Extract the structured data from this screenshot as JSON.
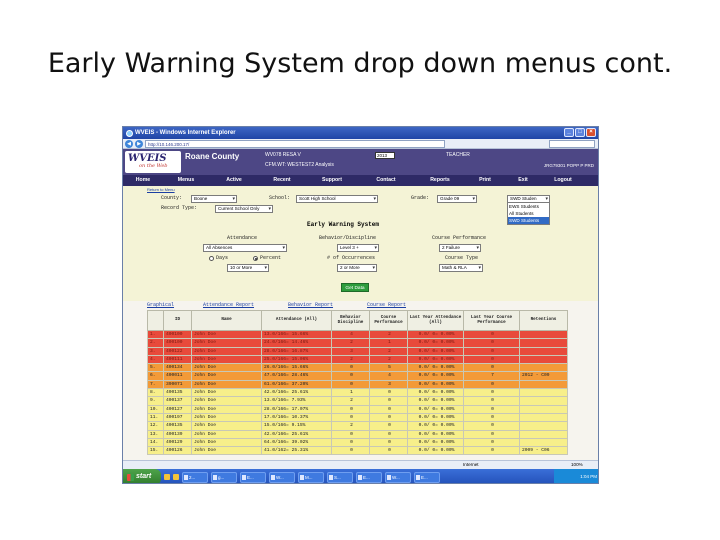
{
  "slide_title": "Early Warning System drop down menus cont.",
  "window": {
    "title": "WVEIS - Windows Internet Explorer",
    "url": "http://10.146.200.17/",
    "status_internet": "Internet",
    "zoom": "100%"
  },
  "app": {
    "logo_main": "WVEIS",
    "logo_sub": "on the Web",
    "county": "Roane County",
    "resa": "WV078 RESA V",
    "analysis": "CFM.WT: WESTEST2 Analysis",
    "year": "2013",
    "role": "TEACHER",
    "user_id": "JRG79301 POPP P PRD"
  },
  "menu": [
    "Home",
    "Menus",
    "Active",
    "Recent",
    "Support",
    "Contact",
    "Reports",
    "Print",
    "Exit",
    "Logout"
  ],
  "filters": {
    "back_link": "Return to Menu",
    "county_label": "County:",
    "county_value": "Boone",
    "school_label": "School:",
    "school_value": "Scott High School",
    "grade_label": "Grade:",
    "grade_value": "Grade 09",
    "student_type_value": "SWD Studen",
    "student_type_options": [
      "EWS Students",
      "All Students",
      "SWD Students"
    ],
    "record_type_label": "Record Type:",
    "record_type_value": "Current School Only",
    "section_title": "Early Warning System",
    "attendance_label": "Attendance",
    "attendance_value": "All Absences",
    "days_label": "Days",
    "percent_label": "Percent",
    "days_value": "10 or More",
    "behavior_label": "Behavior/Discipline",
    "behavior_value": "Level 3 +",
    "occurrences_label": "# of Occurrences",
    "occurrences_value": "2 or More",
    "course_perf_label": "Course Performance",
    "course_perf_value": "2 Failure",
    "course_type_label": "Course Type",
    "course_type_value": "Math & RLA",
    "get_data_label": "Get Data"
  },
  "tabs": [
    "Graphical",
    "Attendance Report",
    "Behavior Report",
    "Course Report"
  ],
  "table": {
    "headers": [
      "",
      "ID",
      "Name",
      "Attendance (All)",
      "Behavior Discipline",
      "Course Performance",
      "Last Year Attendance (All)",
      "Last Year Course Performance",
      "Retentions"
    ],
    "rows": [
      {
        "c": [
          "1.",
          "400100",
          "John Doe",
          "13.0/166= 15.66%",
          "4",
          "2",
          "0.0/ 0= 0.00%",
          "0",
          ""
        ],
        "band": "red"
      },
      {
        "c": [
          "2.",
          "400100",
          "John Doe",
          "24.0/166= 14.46%",
          "2",
          "1",
          "0.0/ 0= 0.00%",
          "0",
          ""
        ],
        "band": "red"
      },
      {
        "c": [
          "3.",
          "400122",
          "John Doe",
          "28.0/166= 16.87%",
          "3",
          "2",
          "0.0/ 0= 0.00%",
          "0",
          ""
        ],
        "band": "red"
      },
      {
        "c": [
          "4.",
          "400111",
          "John Doe",
          "25.0/166= 15.06%",
          "2",
          "2",
          "0.0/ 0= 0.00%",
          "0",
          ""
        ],
        "band": "red"
      },
      {
        "c": [
          "5.",
          "400134",
          "John Doe",
          "26.0/166= 15.66%",
          "0",
          "5",
          "0.0/ 0= 0.00%",
          "0",
          ""
        ],
        "band": "orange"
      },
      {
        "c": [
          "6.",
          "400011",
          "John Doe",
          "47.0/166= 28.46%",
          "0",
          "4",
          "0.0/ 0= 0.00%",
          "7",
          "2012 - C09"
        ],
        "band": "orange"
      },
      {
        "c": [
          "7.",
          "390071",
          "John Doe",
          "61.0/166= 37.20%",
          "0",
          "3",
          "0.0/ 0= 0.00%",
          "0",
          ""
        ],
        "band": "orange"
      },
      {
        "c": [
          "8.",
          "400135",
          "John Doe",
          "42.0/166= 25.61%",
          "1",
          "0",
          "0.0/ 0= 0.00%",
          "0",
          ""
        ],
        "band": "yellow"
      },
      {
        "c": [
          "9.",
          "400137",
          "John Doe",
          "13.0/166= 7.93%",
          "2",
          "0",
          "0.0/ 0= 0.00%",
          "0",
          ""
        ],
        "band": "yellow"
      },
      {
        "c": [
          "10.",
          "400127",
          "John Doe",
          "28.0/166= 17.07%",
          "0",
          "0",
          "0.0/ 0= 0.00%",
          "0",
          ""
        ],
        "band": "yellow"
      },
      {
        "c": [
          "11.",
          "400197",
          "John Doe",
          "17.0/166= 10.37%",
          "0",
          "0",
          "0.0/ 0= 0.00%",
          "0",
          ""
        ],
        "band": "yellow"
      },
      {
        "c": [
          "12.",
          "400135",
          "John Doe",
          "15.0/166= 9.15%",
          "2",
          "0",
          "0.0/ 0= 0.00%",
          "0",
          ""
        ],
        "band": "yellow"
      },
      {
        "c": [
          "13.",
          "400139",
          "John Doe",
          "42.0/166= 25.61%",
          "0",
          "0",
          "0.0/ 0= 0.00%",
          "0",
          ""
        ],
        "band": "yellow"
      },
      {
        "c": [
          "14.",
          "400129",
          "John Doe",
          "64.0/166= 39.02%",
          "0",
          "0",
          "0.0/ 0= 0.00%",
          "0",
          ""
        ],
        "band": "yellow"
      },
      {
        "c": [
          "15.",
          "400126",
          "John Doe",
          "41.0/162= 25.31%",
          "0",
          "0",
          "0.0/ 0= 0.00%",
          "0",
          "2009 - C06"
        ],
        "band": "yellow"
      }
    ]
  },
  "taskbar": {
    "start_label": "start",
    "tasks": [
      "2...",
      "g...",
      "E...",
      "W...",
      "M...",
      "S...",
      "E...",
      "W...",
      "E..."
    ],
    "clock": "1:04 PM"
  },
  "colors": {
    "header": "#4d4785",
    "menubar": "#2e2a66",
    "row_red": "#e84a3b",
    "row_orange": "#f39a38",
    "row_yellow": "#f7ef8a",
    "highlight": "#316ac5"
  }
}
